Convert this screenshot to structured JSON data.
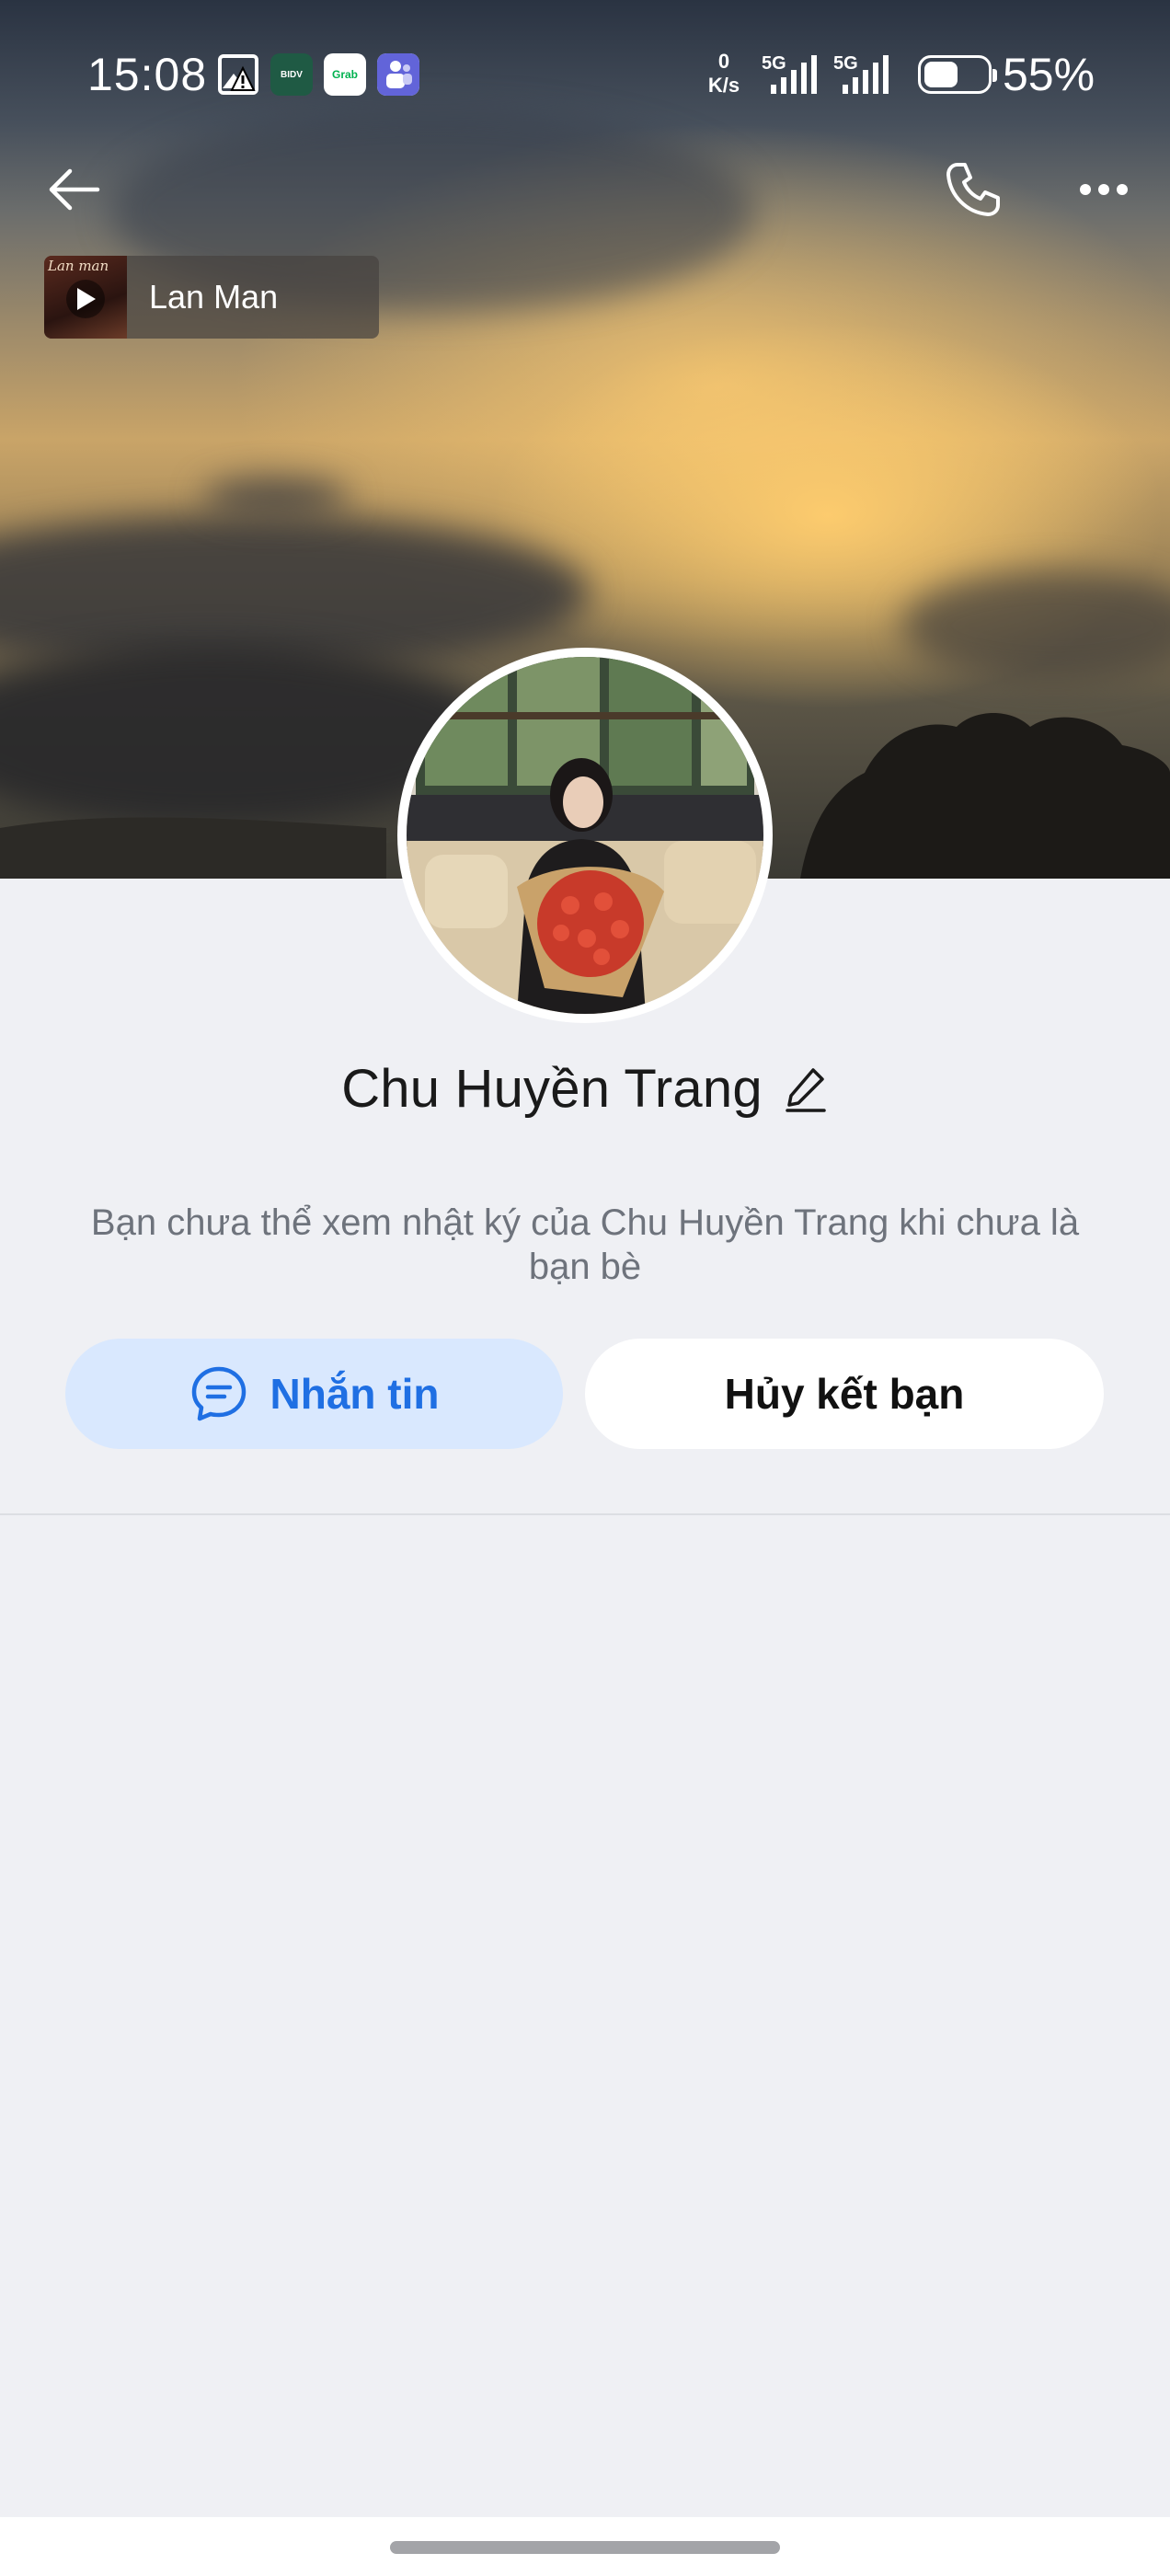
{
  "status_bar": {
    "time": "15:08",
    "net_speed_value": "0",
    "net_speed_unit": "K/s",
    "sim1_label": "5G",
    "sim2_label": "5G",
    "battery_percent": "55%",
    "battery_level": 0.55,
    "app_icons": [
      "gallery-alert-icon",
      "bidv-app-icon",
      "grab-app-icon",
      "teams-app-icon"
    ],
    "bidv_label": "BIDV",
    "grab_label": "Grab"
  },
  "header": {
    "back_icon": "arrow-left-icon",
    "call_icon": "phone-icon",
    "more_icon": "more-horizontal-icon"
  },
  "music": {
    "title": "Lan Man",
    "cover_text": "Lan man"
  },
  "profile": {
    "name": "Chu Huyền Trang",
    "notice": "Bạn chưa thể xem nhật ký của Chu Huyền Trang khi chưa là bạn bè"
  },
  "actions": {
    "message_label": "Nhắn tin",
    "unfriend_label": "Hủy kết bạn"
  },
  "colors": {
    "accent": "#1f6fe3",
    "message_button_bg": "#d9e8fe",
    "page_bg": "#eff0f4"
  }
}
